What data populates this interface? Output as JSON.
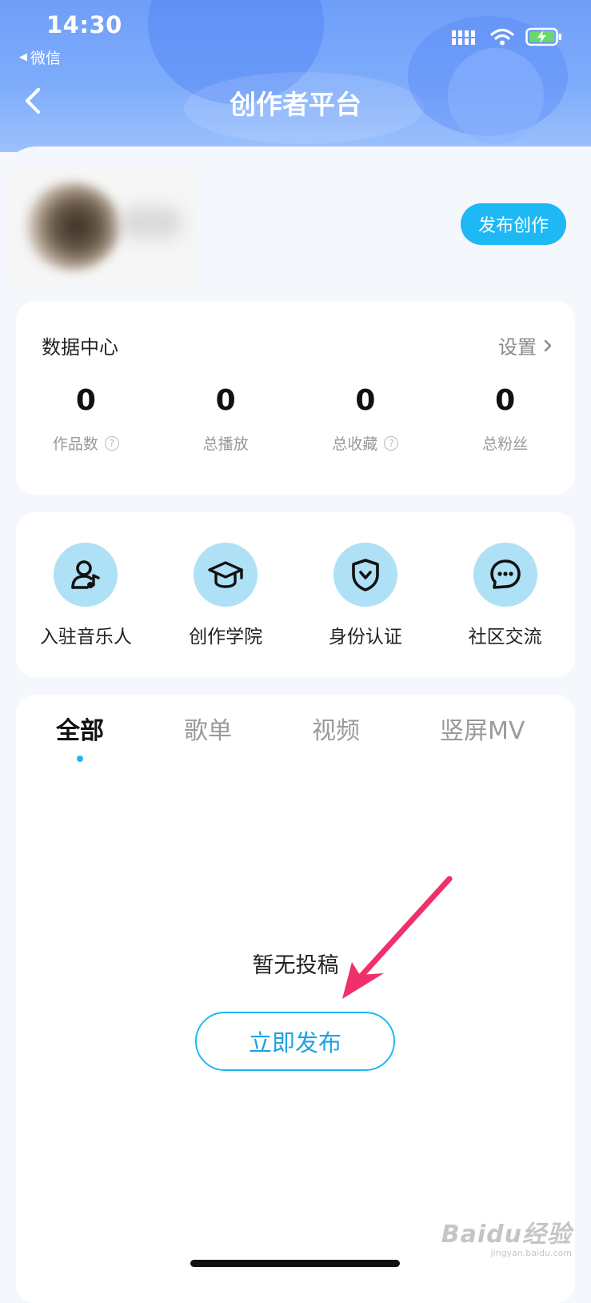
{
  "status_bar": {
    "time": "14:30",
    "back_app": "微信"
  },
  "nav": {
    "title": "创作者平台"
  },
  "profile": {
    "publish_button": "发布创作"
  },
  "data_center": {
    "title": "数据中心",
    "settings_label": "设置",
    "stats": [
      {
        "value": "0",
        "label": "作品数",
        "has_help": true
      },
      {
        "value": "0",
        "label": "总播放",
        "has_help": false
      },
      {
        "value": "0",
        "label": "总收藏",
        "has_help": true
      },
      {
        "value": "0",
        "label": "总粉丝",
        "has_help": false
      }
    ]
  },
  "tools": [
    {
      "label": "入驻音乐人",
      "icon": "musician-icon"
    },
    {
      "label": "创作学院",
      "icon": "graduation-cap-icon"
    },
    {
      "label": "身份认证",
      "icon": "shield-check-icon"
    },
    {
      "label": "社区交流",
      "icon": "chat-bubble-icon"
    }
  ],
  "works": {
    "tabs": [
      "全部",
      "歌单",
      "视频",
      "竖屏MV"
    ],
    "active_tab": 0,
    "empty_text": "暂无投稿",
    "publish_now": "立即发布"
  },
  "watermark": {
    "main": "Baidu经验",
    "sub": "jingyan.baidu.com"
  },
  "colors": {
    "accent": "#1eb8f5",
    "header": "#7eacfb",
    "icon_bg": "#aee0f6",
    "annotation_arrow": "#f0306a"
  }
}
